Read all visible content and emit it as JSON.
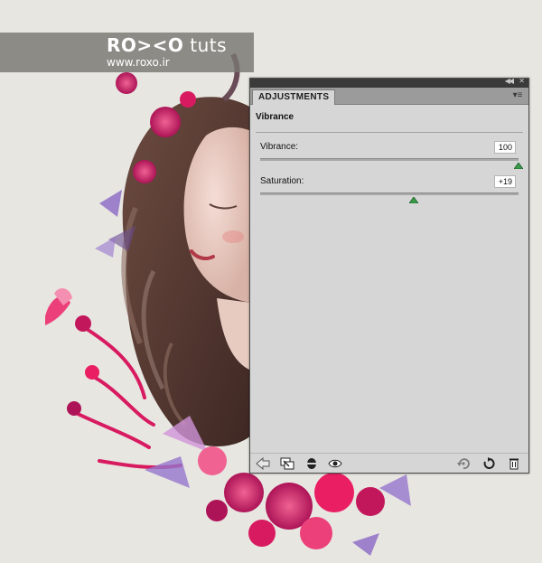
{
  "watermark": {
    "brand_bold": "RO><O",
    "brand_light": "tuts",
    "site": "www.roxo.ir"
  },
  "panel": {
    "tab_label": "ADJUSTMENTS",
    "preset_title": "Vibrance",
    "vibrance": {
      "label": "Vibrance:",
      "value_text": "100",
      "value": 100,
      "min": -100,
      "max": 100
    },
    "saturation": {
      "label": "Saturation:",
      "value_text": "+19",
      "value": 19,
      "min": -100,
      "max": 100
    },
    "slider_thumb_color": "#3a9a48"
  },
  "toolbar_icons": [
    "return-to-list-icon",
    "clip-to-layer-icon",
    "layer-visibility-mask-icon",
    "eye-icon",
    "view-previous-state-icon",
    "reset-icon",
    "delete-icon"
  ],
  "colors": {
    "background": "#e8e6e1",
    "panel_bg": "#d6d6d6",
    "panel_dark_bar": "#3a3a3a",
    "tabbar": "#9b9b9b",
    "flower_pink": "#c2185b",
    "flower_magenta": "#e91e63",
    "leaf_purple": "#7b4f8f",
    "hair_brown": "#5a3a32"
  }
}
